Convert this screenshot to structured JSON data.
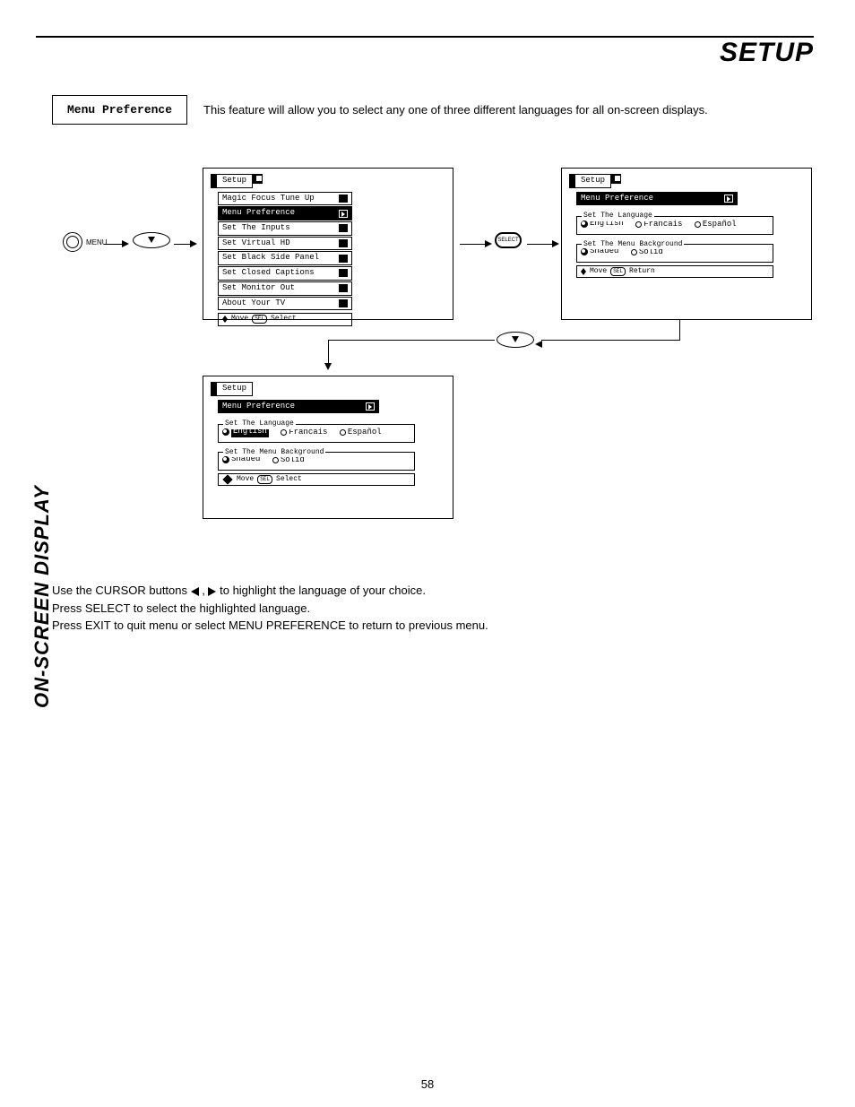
{
  "title": "SETUP",
  "side_tab": "ON-SCREEN DISPLAY",
  "feature": {
    "name": "Menu Preference",
    "description": "This feature will allow you to select any one of three different languages for all on-screen displays."
  },
  "osd_left": {
    "tab": "Setup",
    "items": [
      "Magic Focus Tune Up",
      "Menu Preference",
      "Set The Inputs",
      "Set Virtual HD",
      "Set Black Side Panel",
      "Set Closed Captions",
      "Set Monitor Out",
      "About Your TV"
    ],
    "selected_index": 1,
    "hint_move": "Move",
    "hint_sel": "SEL",
    "hint_select": "Select"
  },
  "osd_right": {
    "tab": "Setup",
    "subtab": "Menu Preference",
    "lang_label": "Set The Language",
    "lang_opts": [
      "English",
      "Francais",
      "Español"
    ],
    "lang_selected": 0,
    "bg_label": "Set The Menu Background",
    "bg_opts": [
      "Shaded",
      "Solid"
    ],
    "bg_selected": 0,
    "hint_move": "Move",
    "hint_sel": "SEL",
    "hint_return": "Return"
  },
  "osd_bottom": {
    "hint_select": "Select"
  },
  "buttons": {
    "menu": "MENU",
    "select": "SELECT"
  },
  "instructions": {
    "line1a": "Use the CURSOR buttons ",
    "line1b": " , ",
    "line1c": " to highlight the language of your choice.",
    "line2": "Press SELECT to select the highlighted language.",
    "line3": "Press EXIT to quit menu or select MENU PREFERENCE to return to previous menu."
  },
  "page_number": "58"
}
